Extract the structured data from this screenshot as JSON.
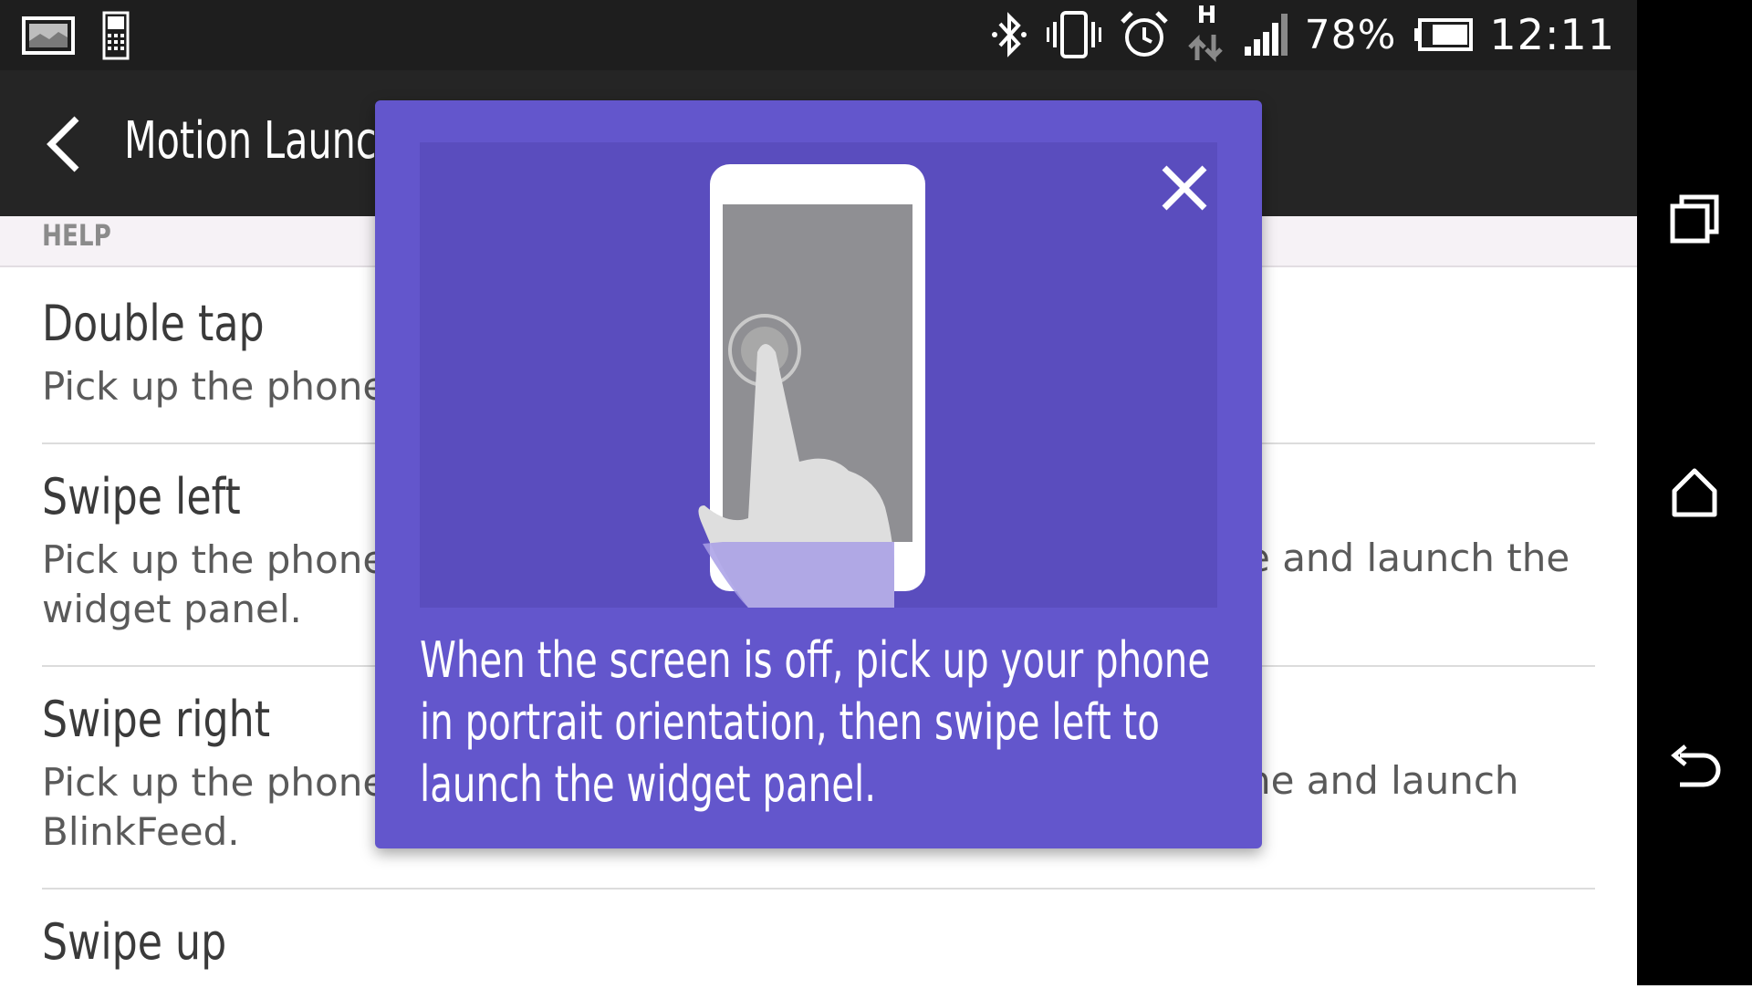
{
  "status_bar": {
    "battery_percent": "78%",
    "time": "12:11",
    "network_type": "H",
    "icons": [
      "gallery-icon",
      "phone-keypad-icon",
      "bluetooth-icon",
      "vibrate-icon",
      "alarm-icon",
      "data-transfer-icon",
      "signal-icon",
      "battery-icon"
    ]
  },
  "app_bar": {
    "title": "Motion Launch"
  },
  "section": {
    "header": "HELP"
  },
  "list": {
    "items": [
      {
        "title": "Double tap",
        "desc_line1": "Pick up the phone",
        "desc_line2": "",
        "desc_right": ""
      },
      {
        "title": "Swipe left",
        "desc_line1": "Pick up the phone",
        "desc_line2": "widget panel.",
        "desc_right": "e and launch the"
      },
      {
        "title": "Swipe right",
        "desc_line1": "Pick up the phone",
        "desc_line2": "BlinkFeed.",
        "desc_right": "ne and launch"
      },
      {
        "title": "Swipe up",
        "desc_line1": "",
        "desc_line2": "",
        "desc_right": ""
      }
    ]
  },
  "dialog": {
    "text": "When the screen is off, pick up your phone in portrait orientation, then swipe left to launch the widget panel."
  },
  "nav_bar": {
    "buttons": [
      "recent-apps",
      "home",
      "back"
    ]
  },
  "colors": {
    "dialog_bg": "#6356cc",
    "illustration_bg": "#5a4dbe",
    "app_bar": "#252525",
    "status_bar": "#1e1e1e"
  }
}
